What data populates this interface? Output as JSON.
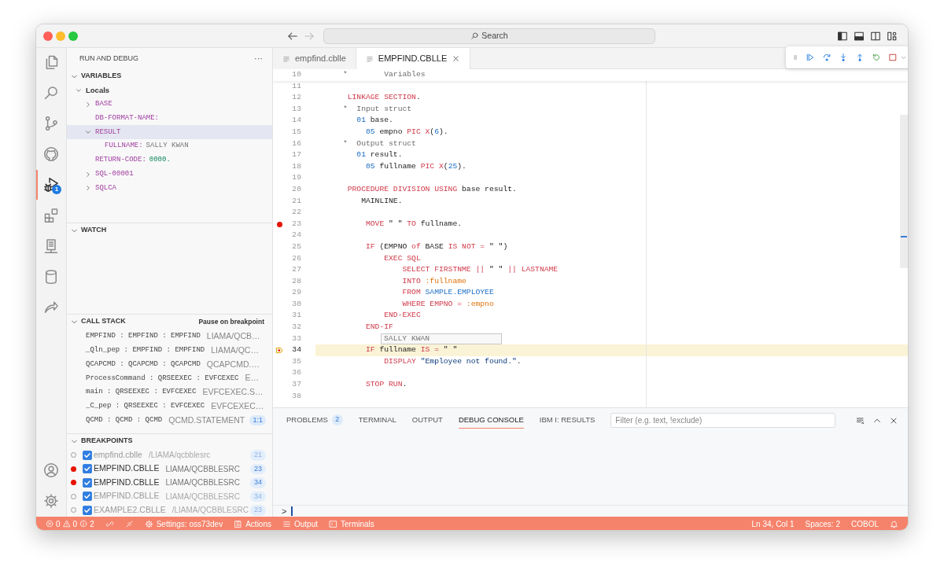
{
  "title_bar": {
    "search": "Search"
  },
  "activity_bar": {
    "items": [
      {
        "kind": "explorer",
        "selected": false
      },
      {
        "kind": "search",
        "selected": false
      },
      {
        "kind": "source-control",
        "selected": false
      },
      {
        "kind": "github",
        "selected": false
      },
      {
        "kind": "run-debug",
        "selected": true,
        "badge": "1"
      },
      {
        "kind": "extensions",
        "selected": false
      },
      {
        "kind": "server",
        "selected": false
      },
      {
        "kind": "database",
        "selected": false
      },
      {
        "kind": "remote",
        "selected": false
      }
    ],
    "bottom_items": [
      {
        "kind": "account"
      },
      {
        "kind": "settings"
      }
    ]
  },
  "sidebar": {
    "title": "RUN AND DEBUG",
    "more": "···",
    "variables": {
      "title": "VARIABLES",
      "expanded": true,
      "tree": [
        {
          "name": "Locals",
          "expanded": true,
          "selected": false,
          "children": [
            {
              "name": "BASE",
              "expanded": false,
              "selected": false
            },
            {
              "name": "DB-FORMAT-NAME:",
              "selected": false
            },
            {
              "name": "RESULT",
              "expanded": true,
              "selected": true,
              "children": [
                {
                  "name": "FULLNAME:",
                  "value": "SALLY KWAN",
                  "kind": "string",
                  "selected": false
                }
              ]
            },
            {
              "name": "RETURN-CODE:",
              "value": "0000.",
              "kind": "number",
              "selected": false
            },
            {
              "name": "SQL-00001",
              "expanded": false,
              "selected": false
            },
            {
              "name": "SQLCA",
              "expanded": false,
              "selected": false
            }
          ]
        }
      ]
    },
    "watch": {
      "title": "WATCH",
      "expanded": true
    },
    "call_stack": {
      "title": "CALL STACK",
      "expanded": true,
      "status": "Pause on breakpoint",
      "frames": [
        {
          "name": "EMPFIND : EMPFIND : EMPFIND",
          "source": "LIAMA/QCB…"
        },
        {
          "name": "_Qln_pep : EMPFIND : EMPFIND",
          "source": "LIAMA/QC…"
        },
        {
          "name": "QCAPCMD : QCAPCMD : QCAPCMD",
          "source": "QCAPCMD.…"
        },
        {
          "name": "ProcessCommand : QRSEEXEC : EVFCEXEC",
          "source": "E…"
        },
        {
          "name": "main : QRSEEXEC : EVFCEXEC",
          "source": "EVFCEXEC.S…"
        },
        {
          "name": "_C_pep : QRSEEXEC : EVFCEXEC",
          "source": "EVFCEXEC…"
        },
        {
          "name": "QCMD : QCMD : QCMD",
          "source": "QCMD.STATEMENT",
          "badge": "1:1"
        }
      ]
    },
    "breakpoints": {
      "title": "BREAKPOINTS",
      "expanded": true,
      "items": [
        {
          "file": "empfind.cblle",
          "path": "/LIAMA/qcbblesrc",
          "line": "21",
          "checked": true,
          "verified": false
        },
        {
          "file": "EMPFIND.CBLLE",
          "path": "LIAMA/QCBBLESRC",
          "line": "23",
          "checked": true,
          "verified": true
        },
        {
          "file": "EMPFIND.CBLLE",
          "path": "LIAMA/QCBBLESRC",
          "line": "34",
          "checked": true,
          "verified": true
        },
        {
          "file": "EMPFIND.CBLLE",
          "path": "LIAMA/QCBBLESRC",
          "line": "34",
          "checked": true,
          "verified": false
        },
        {
          "file": "EXAMPLE2.CBLLE",
          "path": "/LIAMA/QCBBLESRC",
          "line": "23",
          "checked": true,
          "verified": false
        }
      ]
    }
  },
  "editor": {
    "tabs": [
      {
        "label": "empfind.cblle",
        "selected": false
      },
      {
        "label": "EMPFIND.CBLLE",
        "selected": true
      }
    ],
    "debug_toolbar": [
      {
        "kind": "continue"
      },
      {
        "kind": "step-over"
      },
      {
        "kind": "step-into"
      },
      {
        "kind": "step-out"
      },
      {
        "kind": "restart"
      },
      {
        "kind": "stop"
      }
    ],
    "sticky_line": {
      "number": "10",
      "tokens": [
        {
          "text": "      *        Variables",
          "kind": "comment"
        }
      ]
    },
    "lines": [
      {
        "number": "11",
        "breakpoint": false,
        "current": false
      },
      {
        "number": "12",
        "breakpoint": false,
        "current": false,
        "tokens": [
          {
            "text": "       LINKAGE SECTION",
            "kind": "keyword"
          },
          {
            "text": ".",
            "kind": "plain"
          }
        ]
      },
      {
        "number": "13",
        "breakpoint": false,
        "current": false,
        "tokens": [
          {
            "text": "      *  Input struct",
            "kind": "comment"
          }
        ]
      },
      {
        "number": "14",
        "breakpoint": false,
        "current": false,
        "tokens": [
          {
            "text": "         01",
            "kind": "number"
          },
          {
            "text": " base.",
            "kind": "plain"
          }
        ]
      },
      {
        "number": "15",
        "breakpoint": false,
        "current": false,
        "tokens": [
          {
            "text": "           05",
            "kind": "number"
          },
          {
            "text": " empno ",
            "kind": "plain"
          },
          {
            "text": "PIC X",
            "kind": "keyword"
          },
          {
            "text": "(",
            "kind": "plain"
          },
          {
            "text": "6",
            "kind": "number"
          },
          {
            "text": ").",
            "kind": "plain"
          }
        ]
      },
      {
        "number": "16",
        "breakpoint": false,
        "current": false,
        "tokens": [
          {
            "text": "      *  Output struct",
            "kind": "comment"
          }
        ]
      },
      {
        "number": "17",
        "breakpoint": false,
        "current": false,
        "tokens": [
          {
            "text": "         01",
            "kind": "number"
          },
          {
            "text": " result.",
            "kind": "plain"
          }
        ]
      },
      {
        "number": "18",
        "breakpoint": false,
        "current": false,
        "tokens": [
          {
            "text": "           05",
            "kind": "number"
          },
          {
            "text": " fullname ",
            "kind": "plain"
          },
          {
            "text": "PIC X",
            "kind": "keyword"
          },
          {
            "text": "(",
            "kind": "plain"
          },
          {
            "text": "25",
            "kind": "number"
          },
          {
            "text": ").",
            "kind": "plain"
          }
        ]
      },
      {
        "number": "19",
        "breakpoint": false,
        "current": false
      },
      {
        "number": "20",
        "breakpoint": false,
        "current": false,
        "tokens": [
          {
            "text": "       PROCEDURE DIVISION USING",
            "kind": "keyword"
          },
          {
            "text": " base result.",
            "kind": "plain"
          }
        ]
      },
      {
        "number": "21",
        "breakpoint": false,
        "current": false,
        "tokens": [
          {
            "text": "          MAINLINE.",
            "kind": "plain"
          }
        ]
      },
      {
        "number": "22",
        "breakpoint": false,
        "current": false
      },
      {
        "number": "23",
        "breakpoint": true,
        "current": false,
        "tokens": [
          {
            "text": "           MOVE",
            "kind": "keyword"
          },
          {
            "text": " \" \" ",
            "kind": "plain"
          },
          {
            "text": "TO",
            "kind": "keyword"
          },
          {
            "text": " fullname.",
            "kind": "plain"
          }
        ]
      },
      {
        "number": "24",
        "breakpoint": false,
        "current": false
      },
      {
        "number": "25",
        "breakpoint": false,
        "current": false,
        "tokens": [
          {
            "text": "           IF",
            "kind": "keyword"
          },
          {
            "text": " (EMPNO ",
            "kind": "plain"
          },
          {
            "text": "of",
            "kind": "keyword"
          },
          {
            "text": " BASE ",
            "kind": "plain"
          },
          {
            "text": "IS NOT =",
            "kind": "keyword"
          },
          {
            "text": " \" \")",
            "kind": "plain"
          }
        ]
      },
      {
        "number": "26",
        "breakpoint": false,
        "current": false,
        "tokens": [
          {
            "text": "               EXEC SQL",
            "kind": "keyword"
          }
        ]
      },
      {
        "number": "27",
        "breakpoint": false,
        "current": false,
        "tokens": [
          {
            "text": "                   SELECT FIRSTNME || ",
            "kind": "keyword"
          },
          {
            "text": "\" \"",
            "kind": "plain"
          },
          {
            "text": " || LASTNAME",
            "kind": "keyword"
          }
        ]
      },
      {
        "number": "28",
        "breakpoint": false,
        "current": false,
        "tokens": [
          {
            "text": "                   INTO",
            "kind": "keyword"
          },
          {
            "text": " :fullname",
            "kind": "host-variable"
          }
        ]
      },
      {
        "number": "29",
        "breakpoint": false,
        "current": false,
        "tokens": [
          {
            "text": "                   FROM",
            "kind": "keyword"
          },
          {
            "text": " SAMPLE.EMPLOYEE",
            "kind": "table"
          }
        ]
      },
      {
        "number": "30",
        "breakpoint": false,
        "current": false,
        "tokens": [
          {
            "text": "                   WHERE EMPNO =",
            "kind": "keyword"
          },
          {
            "text": " :empno",
            "kind": "host-variable"
          }
        ]
      },
      {
        "number": "31",
        "breakpoint": false,
        "current": false,
        "tokens": [
          {
            "text": "               END-EXEC",
            "kind": "keyword"
          }
        ]
      },
      {
        "number": "32",
        "breakpoint": false,
        "current": false,
        "tokens": [
          {
            "text": "           END-IF",
            "kind": "keyword"
          }
        ]
      },
      {
        "number": "33",
        "breakpoint": false,
        "current": false
      },
      {
        "number": "34",
        "breakpoint": true,
        "current": true,
        "tokens": [
          {
            "text": "           IF",
            "kind": "keyword"
          },
          {
            "text": " fullname ",
            "kind": "plain"
          },
          {
            "text": "IS =",
            "kind": "keyword"
          },
          {
            "text": " \" \"",
            "kind": "plain"
          }
        ]
      },
      {
        "number": "35",
        "breakpoint": false,
        "current": false,
        "tokens": [
          {
            "text": "               DISPLAY",
            "kind": "keyword"
          },
          {
            "text": " \"Employee not found.\"",
            "kind": "string"
          },
          {
            "text": ".",
            "kind": "plain"
          }
        ]
      },
      {
        "number": "36",
        "breakpoint": false,
        "current": false
      },
      {
        "number": "37",
        "breakpoint": false,
        "current": false,
        "tokens": [
          {
            "text": "           STOP RUN",
            "kind": "keyword"
          },
          {
            "text": ".",
            "kind": "plain"
          }
        ]
      },
      {
        "number": "38",
        "breakpoint": false,
        "current": false
      }
    ],
    "hover": "SALLY KWAN"
  },
  "panel": {
    "tabs": [
      {
        "label": "PROBLEMS",
        "selected": false,
        "badge": "2"
      },
      {
        "label": "TERMINAL",
        "selected": false
      },
      {
        "label": "OUTPUT",
        "selected": false
      },
      {
        "label": "DEBUG CONSOLE",
        "selected": true
      },
      {
        "label": "IBM I: RESULTS",
        "selected": false
      }
    ],
    "filter_placeholder": "Filter (e.g. text, !exclude)",
    "prompt": ">"
  },
  "status_bar": {
    "problems": {
      "errors": "0",
      "warnings": "0",
      "infos": "2"
    },
    "left": [
      {
        "kind": "link"
      },
      {
        "kind": "plug"
      },
      {
        "kind": "settings",
        "label": "Settings: oss73dev"
      },
      {
        "kind": "actions",
        "label": "Actions"
      },
      {
        "kind": "output",
        "label": "Output"
      },
      {
        "kind": "terminals",
        "label": "Terminals"
      }
    ],
    "right": [
      {
        "kind": "text",
        "label": "Ln 34, Col 1"
      },
      {
        "kind": "text",
        "label": "Spaces: 2"
      },
      {
        "kind": "text",
        "label": "COBOL"
      },
      {
        "kind": "bell"
      }
    ]
  }
}
